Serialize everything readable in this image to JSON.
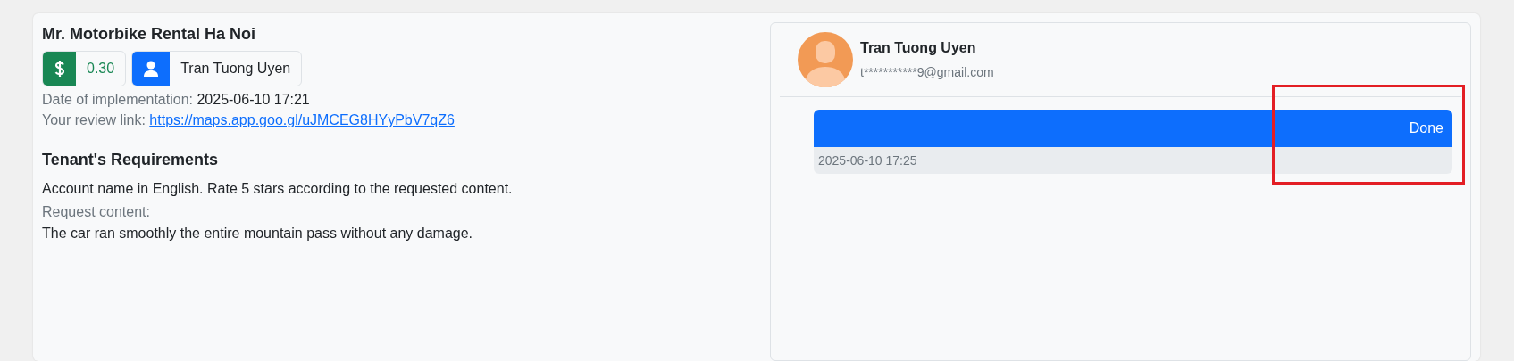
{
  "task": {
    "title": "Mr. Motorbike Rental Ha Noi",
    "reward": "0.30",
    "user": "Tran Tuong Uyen",
    "date_label": "Date of implementation:",
    "date": "2025-06-10 17:21",
    "link_label": "Your review link:",
    "link": "https://maps.app.goo.gl/uJMCEG8HYyPbV7qZ6"
  },
  "requirements": {
    "title": "Tenant's Requirements",
    "text": "Account name in English. Rate 5 stars according to the requested content.",
    "content_label": "Request content:",
    "content": "The car ran smoothly the entire mountain pass without any damage."
  },
  "chat": {
    "name": "Tran Tuong Uyen",
    "email": "t***********9@gmail.com",
    "messages": [
      {
        "text": "Done",
        "time": "2025-06-10 17:25",
        "highlighted": true
      }
    ]
  }
}
